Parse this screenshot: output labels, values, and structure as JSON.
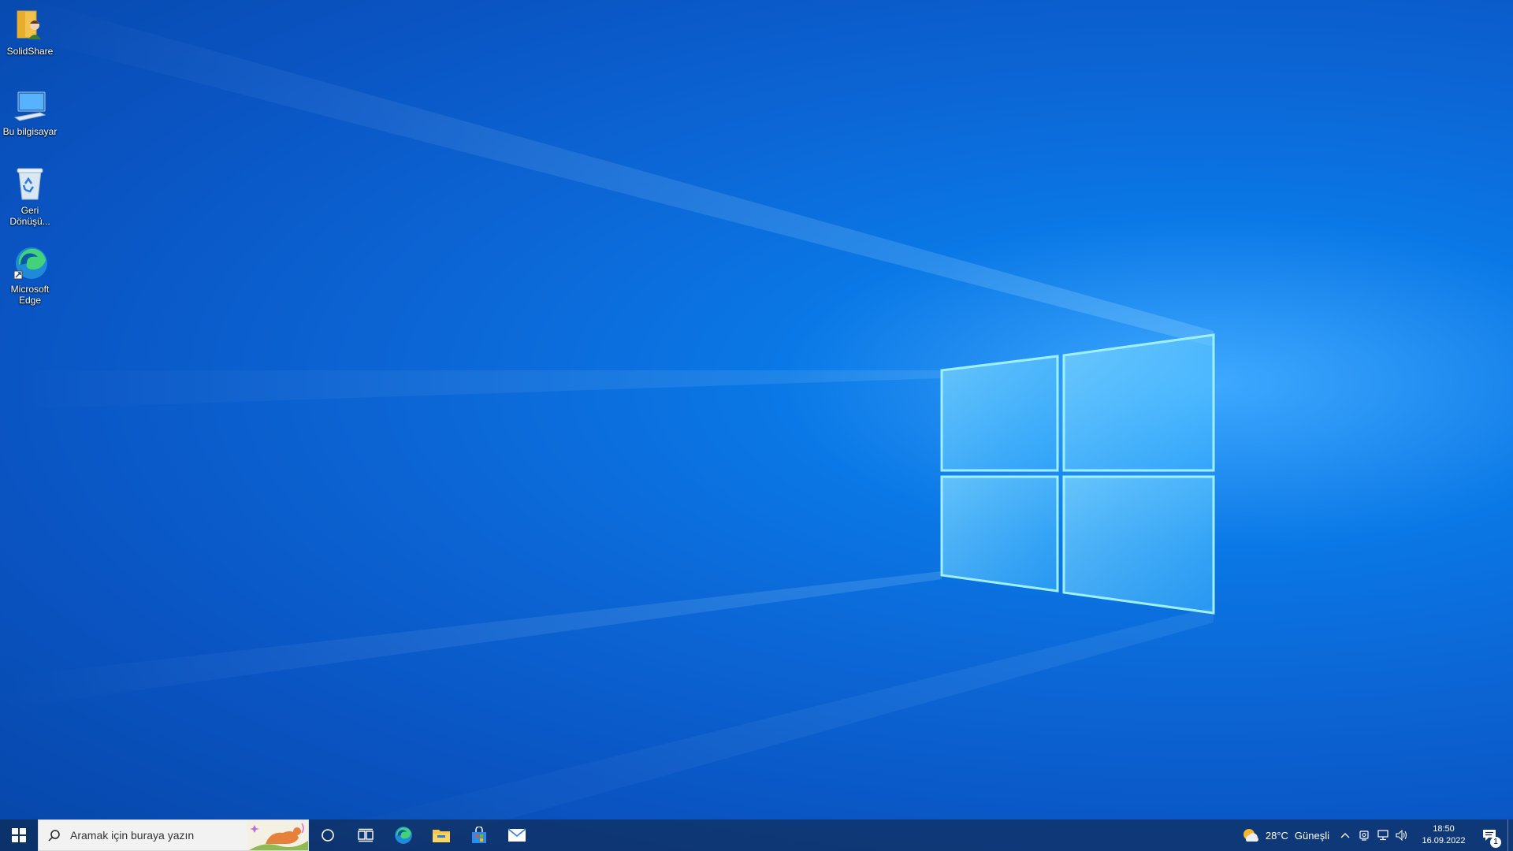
{
  "desktop": {
    "icons": [
      {
        "label": "SolidShare",
        "icon": "user-folder-icon"
      },
      {
        "label": "Bu bilgisayar",
        "icon": "this-pc-icon"
      },
      {
        "label": "Geri Dönüşü...",
        "icon": "recycle-bin-icon"
      },
      {
        "label": "Microsoft Edge",
        "icon": "edge-icon"
      }
    ]
  },
  "taskbar": {
    "search": {
      "placeholder": "Aramak için buraya yazın"
    },
    "pinned": [
      "cortana-icon",
      "task-view-icon",
      "edge-icon",
      "file-explorer-icon",
      "store-icon",
      "mail-icon"
    ],
    "weather": {
      "temp": "28°C",
      "condition": "Güneşli"
    },
    "clock": {
      "time": "18:50",
      "date": "16.09.2022"
    },
    "notifications": {
      "count": "1"
    }
  },
  "colors": {
    "accent": "#0a78e6",
    "taskbar": "#122038"
  }
}
